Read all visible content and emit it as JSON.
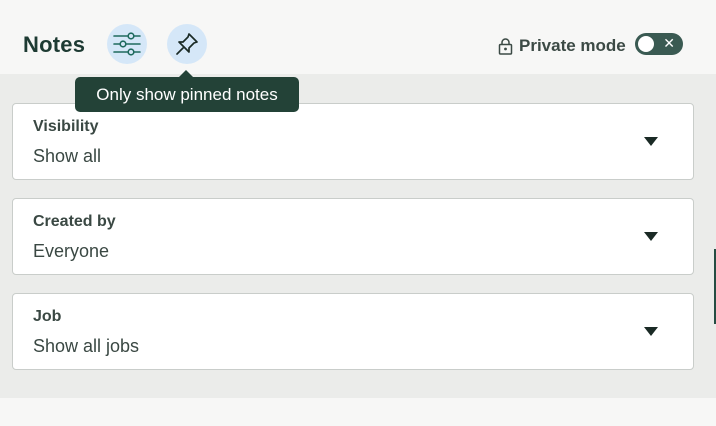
{
  "header": {
    "title": "Notes",
    "filter_icon": "sliders-icon",
    "pin_icon": "pin-icon",
    "private_mode": {
      "icon": "lock-icon",
      "label": "Private mode",
      "enabled": false,
      "off_glyph": "✕"
    }
  },
  "tooltip": {
    "text": "Only show pinned notes"
  },
  "filters": [
    {
      "label": "Visibility",
      "value": "Show all"
    },
    {
      "label": "Created by",
      "value": "Everyone"
    },
    {
      "label": "Job",
      "value": "Show all jobs"
    }
  ],
  "colors": {
    "brand_dark": "#1e3b33",
    "tooltip_bg": "#234237",
    "icon_button_bg": "#d5e7f8",
    "toggle_bg": "#3a5a52",
    "panel_bg": "#ebecea"
  }
}
